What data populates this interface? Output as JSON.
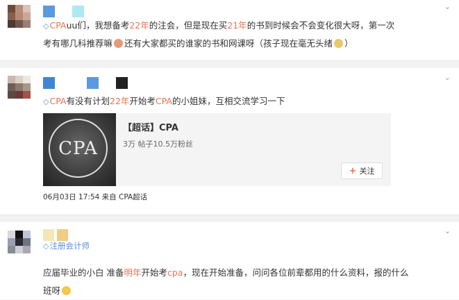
{
  "posts": [
    {
      "topic": "CPA",
      "text_a": "uu们，我想备考",
      "highlight_1": "22年",
      "text_b": "的注会，但是现在买",
      "highlight_2": "21年",
      "text_c": "的书到时候会不会变化很大呀，第一次",
      "line2_a": "考有哪几科推荐嘛",
      "line2_b": "还有大家都买的谁家的书和网课呀（孩子现在毫无头绪",
      "line2_c": "）",
      "more_icon": "chevron-down-icon"
    },
    {
      "topic": "CPA",
      "text_a": "有没有计划",
      "highlight_1": "22年",
      "text_b": "开始考",
      "highlight_2": "CPA",
      "text_c": "的小姐妹，互相交流学习一下",
      "share": {
        "logo_text": "CPA",
        "title": "【超话】CPA",
        "subtitle": "3万  帖子10.5万粉丝",
        "follow_label": "关注"
      },
      "meta": "06月03日 17:54  来自 CPA超话",
      "more_icon": "chevron-down-icon"
    },
    {
      "source": "注册会计师",
      "line1_a": "应届毕业的小白 准备",
      "highlight_1": "明年",
      "line1_b": "开始考",
      "highlight_2": "cpa",
      "line1_c": "，现在开始准备，问问各位前辈都用的什么资料，报的什么",
      "line2_a": "班呀",
      "more_icon": "chevron-down-icon"
    }
  ]
}
